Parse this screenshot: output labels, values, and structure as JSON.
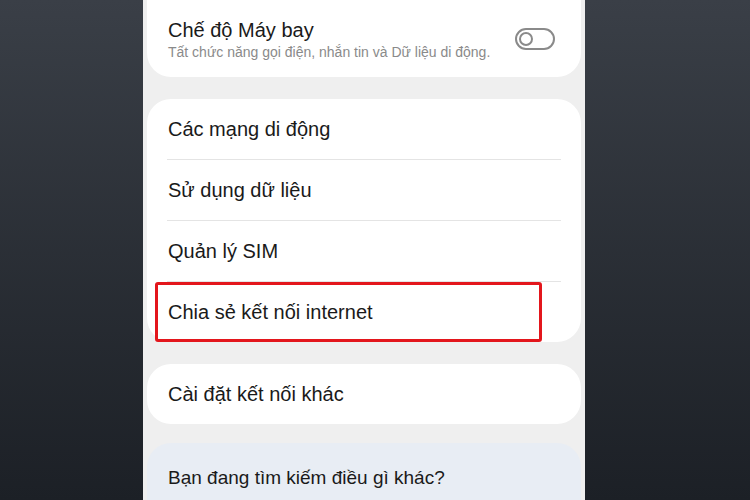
{
  "settings_groups": [
    {
      "items": [
        {
          "title": "Chế độ Máy bay",
          "subtitle": "Tất chức năng gọi điện, nhắn tin và Dữ liệu di động.",
          "kind": "toggle",
          "on": false,
          "highlighted": false
        }
      ]
    },
    {
      "items": [
        {
          "title": "Các mạng di động",
          "kind": "link",
          "highlighted": false
        },
        {
          "title": "Sử dụng dữ liệu",
          "kind": "link",
          "highlighted": false
        },
        {
          "title": "Quản lý SIM",
          "kind": "link",
          "highlighted": false
        },
        {
          "title": "Chia sẻ kết nối internet",
          "kind": "link",
          "highlighted": true
        }
      ]
    },
    {
      "items": [
        {
          "title": "Cài đặt kết nối khác",
          "kind": "link",
          "highlighted": false
        }
      ]
    }
  ],
  "search_prompt": {
    "text": "Bạn đang tìm kiếm điều gì khác?"
  }
}
